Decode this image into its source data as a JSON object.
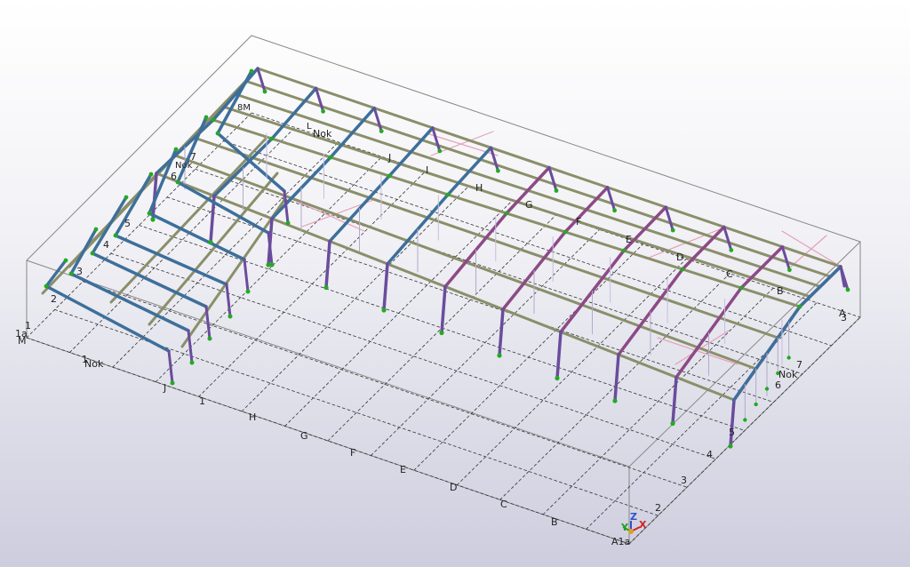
{
  "view": {
    "background_top": "#ffffff",
    "background_bottom": "#cdcdde"
  },
  "grid": {
    "row_labels": [
      "A1a",
      "B",
      "C",
      "D",
      "E",
      "F",
      "G",
      "H",
      "1",
      "J",
      "Nok",
      "1",
      "M",
      "1a",
      "1"
    ],
    "column_labels": [
      "2",
      "3",
      "4",
      "5"
    ],
    "far_labels": [
      "A",
      "B",
      "C",
      "D",
      "E",
      "F",
      "G",
      "H",
      "I",
      "J",
      "Nok",
      "M"
    ],
    "far_column_labels": [
      "2",
      "3",
      "4",
      "5",
      "6",
      "7",
      "8"
    ],
    "right_column_labels": [
      "6",
      "7",
      "Nok",
      "3"
    ]
  },
  "frame_labels": {
    "top_1": "8M",
    "top_2": "7",
    "top_3": "Nok",
    "top_4": "6",
    "top_5": "Nok",
    "top_6": "L"
  },
  "axes": {
    "x": "X",
    "y": "Y",
    "z": "Z",
    "x_color": "#d22020",
    "y_color": "#20a020",
    "z_color": "#3050d0"
  },
  "colors": {
    "purlin": "#8a8f6a",
    "column_purple": "#6a4c9c",
    "rafter_purple": "#8c4a86",
    "rafter_blue": "#3d6f9a",
    "bracing": "#e6a0b8",
    "support": "#22aa22",
    "gridline": "#333333",
    "bbox": "#888888"
  }
}
